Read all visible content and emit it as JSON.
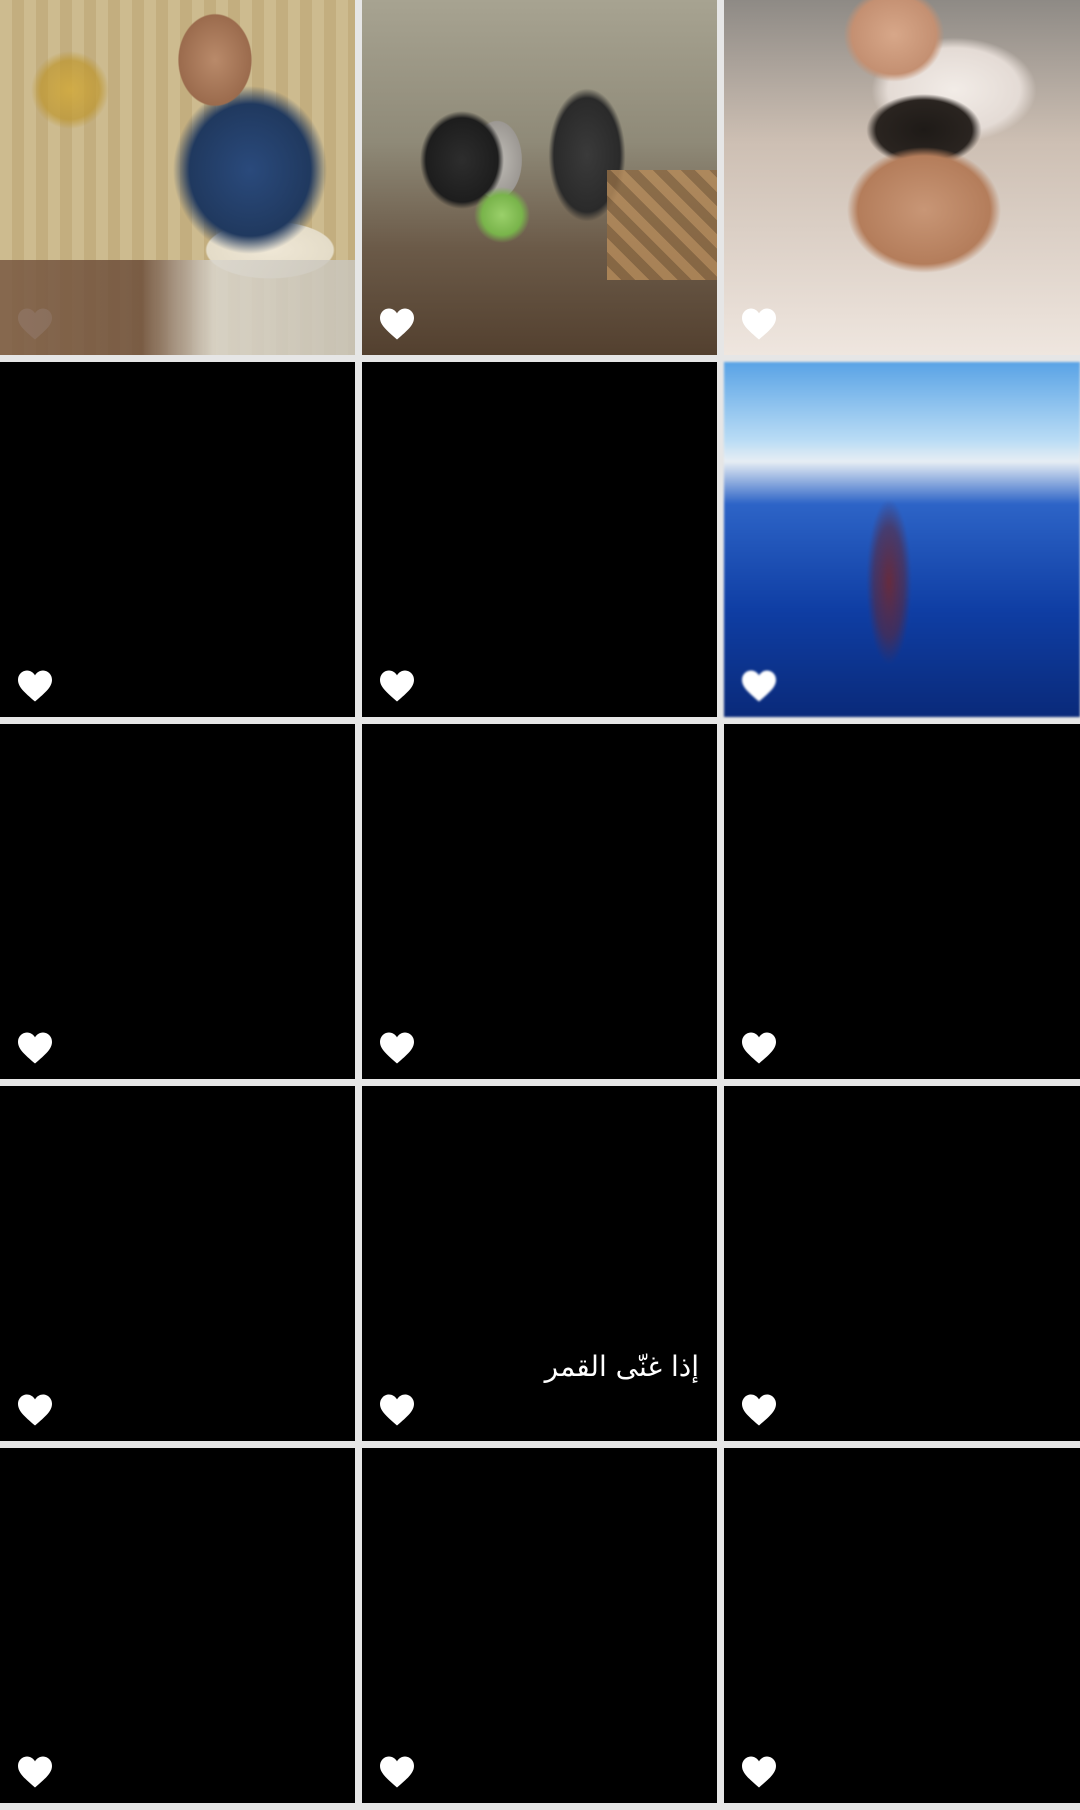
{
  "grid": {
    "tiles": [
      {
        "kind": "photo",
        "subject": "man-on-phone",
        "liked": true
      },
      {
        "kind": "photo",
        "subject": "group-with-tape-recorder",
        "liked": true
      },
      {
        "kind": "photo",
        "subject": "man-with-baby",
        "liked": true
      },
      {
        "kind": "blank",
        "liked": true
      },
      {
        "kind": "blank",
        "liked": true
      },
      {
        "kind": "blurred",
        "liked": true
      },
      {
        "kind": "blank",
        "liked": true
      },
      {
        "kind": "blank",
        "liked": true
      },
      {
        "kind": "blank",
        "liked": true
      },
      {
        "kind": "blank",
        "liked": true
      },
      {
        "kind": "caption",
        "liked": true,
        "caption": "إذا غنّى القمر"
      },
      {
        "kind": "blank",
        "liked": true
      },
      {
        "kind": "blank",
        "liked": true
      },
      {
        "kind": "blank",
        "liked": true
      },
      {
        "kind": "blank",
        "liked": true
      }
    ]
  },
  "icons": {
    "like": "heart-icon",
    "like_color": "#ffffff"
  }
}
